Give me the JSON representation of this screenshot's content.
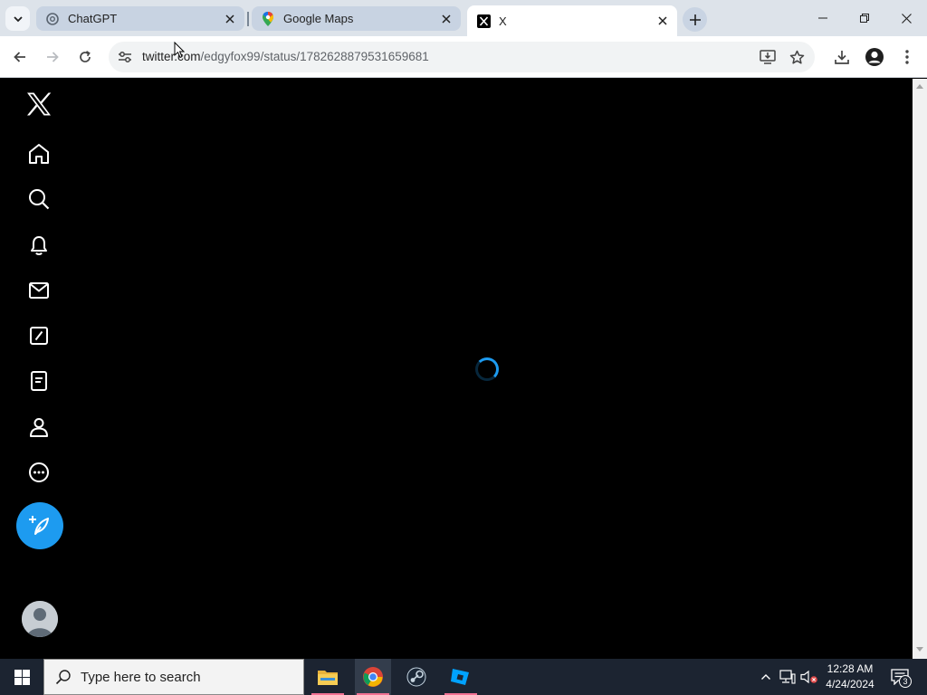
{
  "browser": {
    "tabs": [
      {
        "title": "ChatGPT",
        "favicon": "chatgpt-icon",
        "active": false
      },
      {
        "title": "Google Maps",
        "favicon": "google-maps-icon",
        "active": false
      },
      {
        "title": "X",
        "favicon": "x-logo-icon",
        "active": true
      }
    ],
    "url_host": "twitter.com",
    "url_path": "/edgyfox99/status/1782628879531659681",
    "colors": {
      "tabstrip": "#dde3ea",
      "toolbar": "#ffffff",
      "omnibox": "#f1f3f4"
    }
  },
  "x_app": {
    "nav_items": [
      "x-logo-icon",
      "home-icon",
      "search-icon",
      "notifications-icon",
      "messages-icon",
      "grok-icon",
      "lists-icon",
      "profile-icon",
      "more-icon"
    ],
    "post_button_icon": "compose-post-icon",
    "state": "loading",
    "colors": {
      "background": "#000000",
      "accent": "#1d9bf0"
    }
  },
  "taskbar": {
    "search_placeholder": "Type here to search",
    "apps": [
      "file-explorer-icon",
      "chrome-icon",
      "steam-icon",
      "roblox-studio-icon"
    ],
    "time": "12:28 AM",
    "date": "4/24/2024",
    "notification_count": "3"
  }
}
